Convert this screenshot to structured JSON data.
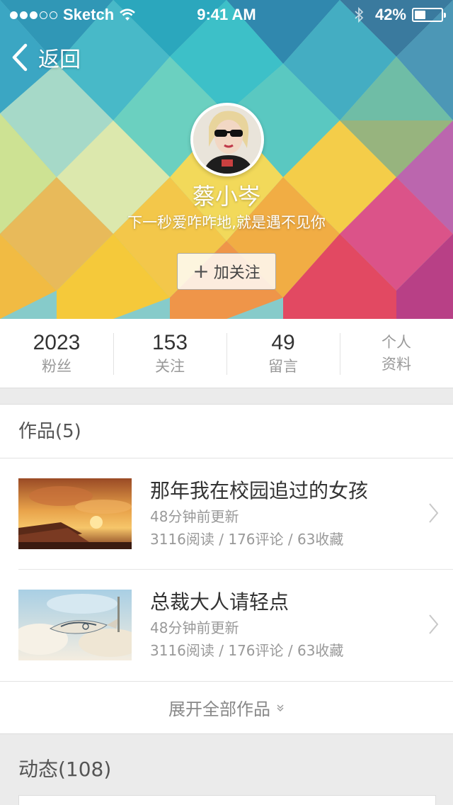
{
  "status_bar": {
    "carrier": "Sketch",
    "time": "9:41 AM",
    "battery": "42%",
    "battery_level": 0.42,
    "signal_bars": 3,
    "signal_total": 5
  },
  "nav": {
    "back_label": "返回"
  },
  "profile": {
    "name": "蔡小岑",
    "motto": "下一秒爱咋咋地,就是遇不见你",
    "follow_label": "加关注",
    "follow_icon": "plus-icon"
  },
  "stats": [
    {
      "value": "2023",
      "label": "粉丝"
    },
    {
      "value": "153",
      "label": "关注"
    },
    {
      "value": "49",
      "label": "留言"
    }
  ],
  "profile_link": {
    "line1": "个人",
    "line2": "资料"
  },
  "works": {
    "title": "作品(5)",
    "items": [
      {
        "title": "那年我在校园追过的女孩",
        "updated": "48分钟前更新",
        "stats": "3116阅读 / 176评论 / 63收藏"
      },
      {
        "title": "总裁大人请轻点",
        "updated": "48分钟前更新",
        "stats": "3116阅读 / 176评论 / 63收藏"
      }
    ],
    "expand_label": "展开全部作品"
  },
  "activity": {
    "title": "动态(108)"
  },
  "colors": {
    "accent_text": "#333333",
    "muted_text": "#999999",
    "background": "#ebebeb"
  }
}
